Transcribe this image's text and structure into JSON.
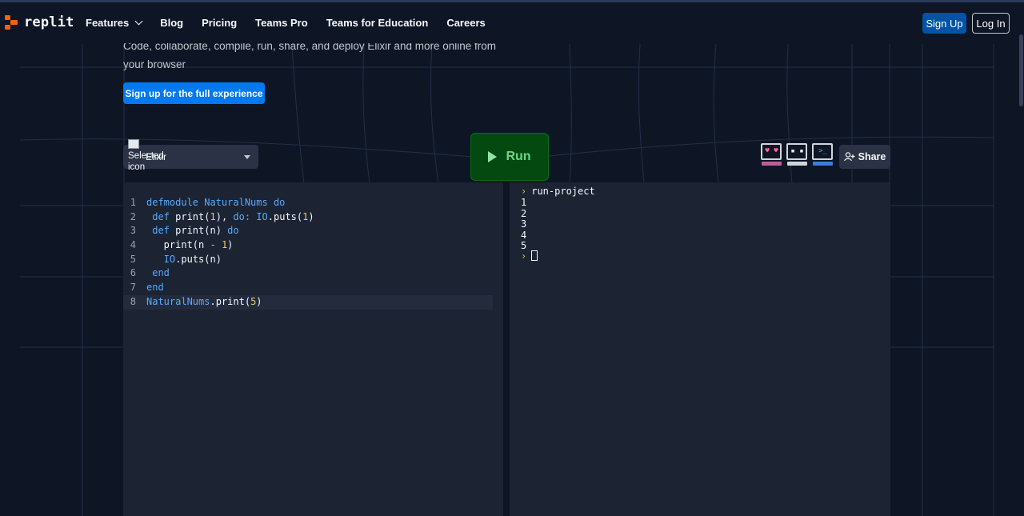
{
  "nav": {
    "logo_text": "replit",
    "links": [
      "Features",
      "Blog",
      "Pricing",
      "Teams Pro",
      "Teams for Education",
      "Careers"
    ],
    "signup_label": "Sign Up",
    "login_label": "Log In"
  },
  "hero": {
    "subtitle": "Code, collaborate, compile, run, share, and deploy Elixir and more online from your browser",
    "cta_label": "Sign up for the full experience"
  },
  "toolbar": {
    "broken_image_alt": "Selected icon",
    "language_value": "Elixir",
    "run_label": "Run",
    "share_label": "Share",
    "avatars": [
      "heart-eyes-icon",
      "neutral-face-icon",
      "terminal-face-icon"
    ]
  },
  "editor": {
    "lines": [
      {
        "n": "1",
        "tokens": [
          {
            "t": "defmodule ",
            "c": "kw"
          },
          {
            "t": "NaturalNums ",
            "c": "tp"
          },
          {
            "t": "do",
            "c": "kw"
          }
        ]
      },
      {
        "n": "2",
        "tokens": [
          {
            "t": " def ",
            "c": "kw"
          },
          {
            "t": "print(",
            "c": "fn"
          },
          {
            "t": "1",
            "c": "num"
          },
          {
            "t": "), ",
            "c": "fn"
          },
          {
            "t": "do: ",
            "c": "kw"
          },
          {
            "t": "IO",
            "c": "tp"
          },
          {
            "t": ".puts(",
            "c": "fn"
          },
          {
            "t": "1",
            "c": "num"
          },
          {
            "t": ")",
            "c": "fn"
          }
        ]
      },
      {
        "n": "3",
        "tokens": [
          {
            "t": " def ",
            "c": "kw"
          },
          {
            "t": "print(n) ",
            "c": "fn"
          },
          {
            "t": "do",
            "c": "kw"
          }
        ]
      },
      {
        "n": "4",
        "tokens": [
          {
            "t": "   print(n ",
            "c": "fn"
          },
          {
            "t": "- ",
            "c": "op"
          },
          {
            "t": "1",
            "c": "num"
          },
          {
            "t": ")",
            "c": "fn"
          }
        ]
      },
      {
        "n": "5",
        "tokens": [
          {
            "t": "   ",
            "c": "fn"
          },
          {
            "t": "IO",
            "c": "tp"
          },
          {
            "t": ".puts(n)",
            "c": "fn"
          }
        ]
      },
      {
        "n": "6",
        "tokens": [
          {
            "t": " end",
            "c": "kw"
          }
        ]
      },
      {
        "n": "7",
        "tokens": [
          {
            "t": "end",
            "c": "kw"
          }
        ]
      },
      {
        "n": "8",
        "tokens": [
          {
            "t": "NaturalNums",
            "c": "tp"
          },
          {
            "t": ".print(",
            "c": "fn"
          },
          {
            "t": "5",
            "c": "num"
          },
          {
            "t": ")",
            "c": "fn"
          }
        ]
      }
    ],
    "active_line": 8
  },
  "console": {
    "command": "run-project",
    "output": [
      "1",
      "2",
      "3",
      "4",
      "5"
    ]
  },
  "colors": {
    "background": "#0e1525",
    "panel": "#1c2333",
    "accent_blue": "#0079f2",
    "run_green": "#044a10",
    "logo_orange": "#f26207"
  }
}
